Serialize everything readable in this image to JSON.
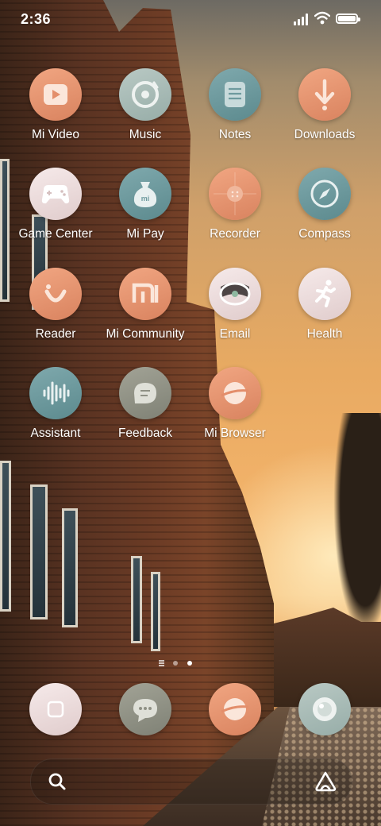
{
  "status_bar": {
    "time": "2:36",
    "signal_icon": "signal-icon",
    "wifi_icon": "wifi-icon",
    "battery_icon": "battery-icon"
  },
  "apps": [
    {
      "label": "Mi Video",
      "icon": "play-icon",
      "color": "#e38e6b"
    },
    {
      "label": "Music",
      "icon": "vinyl-icon",
      "color": "#a9bdb8"
    },
    {
      "label": "Notes",
      "icon": "notes-icon",
      "color": "#6e9a9e"
    },
    {
      "label": "Downloads",
      "icon": "download-arrow-icon",
      "color": "#e38e6b"
    },
    {
      "label": "Game Center",
      "icon": "gamepad-icon",
      "color": "#ead9d9"
    },
    {
      "label": "Mi Pay",
      "icon": "money-bag-icon",
      "color": "#6e9a9e"
    },
    {
      "label": "Recorder",
      "icon": "recorder-icon",
      "color": "#e38e6b"
    },
    {
      "label": "Compass",
      "icon": "compass-icon",
      "color": "#6e9a9e"
    },
    {
      "label": "Reader",
      "icon": "smile-reader-icon",
      "color": "#e38e6b"
    },
    {
      "label": "Mi Community",
      "icon": "mi-logo-icon",
      "color": "#e38e6b"
    },
    {
      "label": "Email",
      "icon": "email-icon",
      "color": "#ead9d9"
    },
    {
      "label": "Health",
      "icon": "running-person-icon",
      "color": "#ead9d9"
    },
    {
      "label": "Assistant",
      "icon": "voice-wave-icon",
      "color": "#6e9a9e"
    },
    {
      "label": "Feedback",
      "icon": "chat-bubble-icon",
      "color": "#8f9185"
    },
    {
      "label": "Mi Browser",
      "icon": "planet-icon",
      "color": "#e38e6b"
    }
  ],
  "dock": [
    {
      "icon": "phone-square-icon",
      "color": "#ead9d9"
    },
    {
      "icon": "messages-icon",
      "color": "#8f9185"
    },
    {
      "icon": "browser-planet-icon",
      "color": "#e38e6b"
    },
    {
      "icon": "camera-icon",
      "color": "#a9bdb8"
    }
  ],
  "page_indicator": {
    "pages": 2,
    "current": 2
  },
  "search": {
    "placeholder": "",
    "search_icon": "search-icon",
    "assistant_icon": "assistant-logo-icon"
  }
}
